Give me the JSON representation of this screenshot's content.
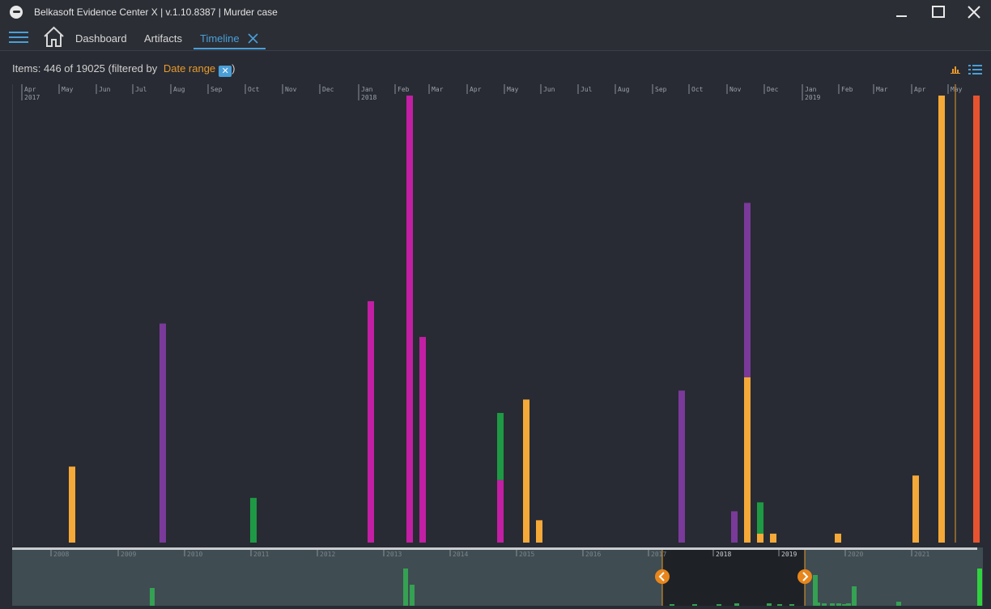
{
  "window": {
    "title": "Belkasoft Evidence Center X | v.1.10.8387 | Murder case",
    "controls": [
      "minimize-icon",
      "maximize-icon",
      "close-icon"
    ]
  },
  "nav": {
    "tabs": [
      {
        "label": "Dashboard"
      },
      {
        "label": "Artifacts"
      },
      {
        "label": "Timeline",
        "active": true
      }
    ]
  },
  "filter": {
    "items_label": "Items: 446 of 19025 (filtered by",
    "filter_link": "Date range",
    "close_paren": ")"
  },
  "colors": {
    "orange": "#f5a938",
    "purple": "#7a3a9a",
    "magenta": "#c21fa4",
    "green": "#1e9a44",
    "red": "#e8532f",
    "accent": "#4a9fd8"
  },
  "timeline": {
    "month_labels": [
      {
        "label": "Apr",
        "year": "2017"
      },
      {
        "label": "May"
      },
      {
        "label": "Jun"
      },
      {
        "label": "Jul"
      },
      {
        "label": "Aug"
      },
      {
        "label": "Sep"
      },
      {
        "label": "Oct"
      },
      {
        "label": "Nov"
      },
      {
        "label": "Dec"
      },
      {
        "label": "Jan",
        "year": "2018"
      },
      {
        "label": "Feb"
      },
      {
        "label": "Mar"
      },
      {
        "label": "Apr"
      },
      {
        "label": "May"
      },
      {
        "label": "Jun"
      },
      {
        "label": "Jul"
      },
      {
        "label": "Aug"
      },
      {
        "label": "Sep"
      },
      {
        "label": "Oct"
      },
      {
        "label": "Nov"
      },
      {
        "label": "Dec"
      },
      {
        "label": "Jan",
        "year": "2019"
      },
      {
        "label": "Feb"
      },
      {
        "label": "Mar"
      },
      {
        "label": "Apr"
      },
      {
        "label": "May"
      }
    ]
  },
  "chart_data": {
    "type": "bar",
    "unit": "month",
    "x_range": [
      "2017-04",
      "2019-05"
    ],
    "ylim": [
      0,
      100
    ],
    "bars": [
      {
        "x": "2017-05",
        "segments": [
          {
            "color": "orange",
            "value": 17
          }
        ]
      },
      {
        "x": "2017-07",
        "segments": [
          {
            "color": "purple",
            "value": 49
          }
        ]
      },
      {
        "x": "2017-10",
        "segments": [
          {
            "color": "green",
            "value": 10
          }
        ]
      },
      {
        "x": "2018-01",
        "segments": [
          {
            "color": "magenta",
            "value": 54
          }
        ]
      },
      {
        "x": "2018-02a",
        "segments": [
          {
            "color": "magenta",
            "value": 100
          }
        ]
      },
      {
        "x": "2018-02b",
        "segments": [
          {
            "color": "magenta",
            "value": 46
          }
        ]
      },
      {
        "x": "2018-04",
        "segments": [
          {
            "color": "magenta",
            "value": 14
          },
          {
            "color": "green",
            "value": 15
          }
        ]
      },
      {
        "x": "2018-05a",
        "segments": [
          {
            "color": "orange",
            "value": 32
          }
        ]
      },
      {
        "x": "2018-05b",
        "segments": [
          {
            "color": "orange",
            "value": 5
          }
        ]
      },
      {
        "x": "2018-09",
        "segments": [
          {
            "color": "purple",
            "value": 34
          }
        ]
      },
      {
        "x": "2018-11a",
        "segments": [
          {
            "color": "purple",
            "value": 7
          }
        ]
      },
      {
        "x": "2018-11b",
        "segments": [
          {
            "color": "orange",
            "value": 37
          },
          {
            "color": "purple",
            "value": 39
          }
        ]
      },
      {
        "x": "2018-11c",
        "segments": [
          {
            "color": "orange",
            "value": 2
          },
          {
            "color": "green",
            "value": 7
          }
        ]
      },
      {
        "x": "2018-11d",
        "segments": [
          {
            "color": "orange",
            "value": 2
          }
        ]
      },
      {
        "x": "2019-01",
        "segments": [
          {
            "color": "orange",
            "value": 2
          }
        ]
      },
      {
        "x": "2019-04",
        "segments": [
          {
            "color": "orange",
            "value": 15
          }
        ]
      },
      {
        "x": "2019-05a",
        "segments": [
          {
            "color": "orange",
            "value": 100
          }
        ]
      },
      {
        "x": "2019-05b",
        "segments": [
          {
            "color": "red",
            "value": 100
          }
        ]
      }
    ],
    "overview": {
      "years": [
        "2008",
        "2009",
        "2010",
        "2011",
        "2012",
        "2013",
        "2014",
        "2015",
        "2016",
        "2017",
        "2018",
        "2019",
        "2020",
        "2021"
      ],
      "selected_range": [
        "2017",
        "2019"
      ]
    }
  }
}
